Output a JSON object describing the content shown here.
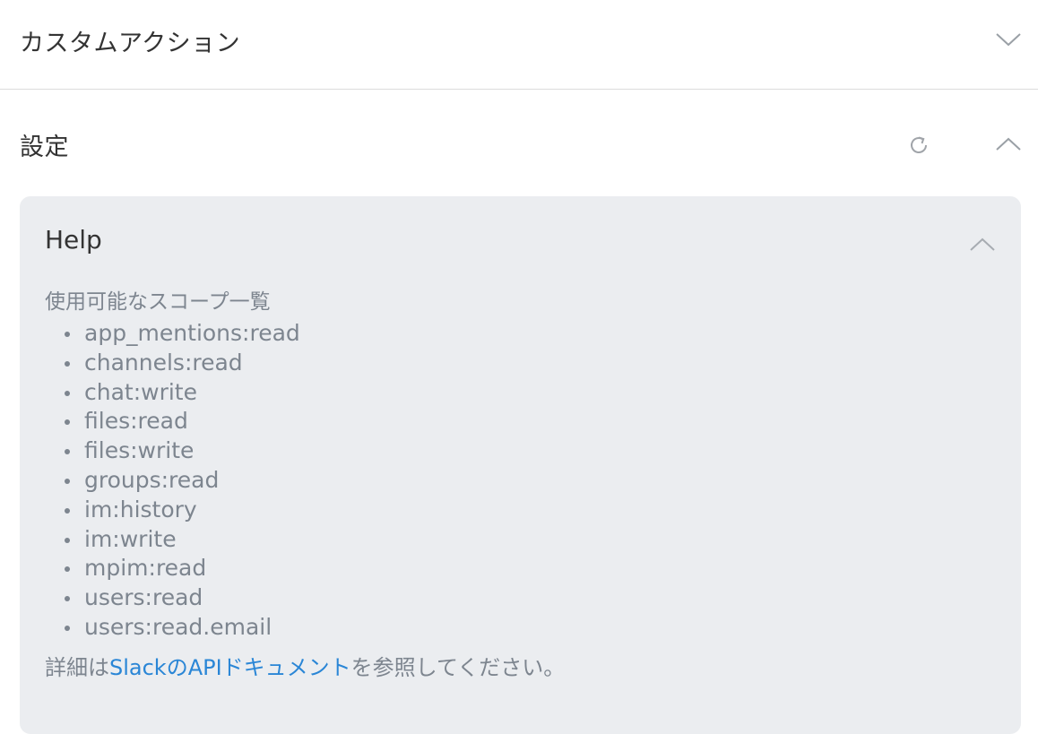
{
  "custom_action": {
    "title": "カスタムアクション"
  },
  "settings": {
    "title": "設定"
  },
  "help": {
    "title": "Help",
    "scopes_intro": "使用可能なスコープ一覧",
    "scopes": [
      "app_mentions:read",
      "channels:read",
      "chat:write",
      "files:read",
      "files:write",
      "groups:read",
      "im:history",
      "im:write",
      "mpim:read",
      "users:read",
      "users:read.email"
    ],
    "footer_prefix": "詳細は",
    "footer_link": "SlackのAPIドキュメント",
    "footer_suffix": "を参照してください。"
  },
  "icons": {
    "collapse_custom_action": "chevron-down-icon",
    "refresh": "refresh-icon",
    "collapse_settings": "chevron-up-icon",
    "collapse_help": "chevron-up-icon"
  },
  "colors": {
    "link": "#2a86d6",
    "help_bg": "#ebedf0",
    "muted_text": "#7d858f"
  }
}
